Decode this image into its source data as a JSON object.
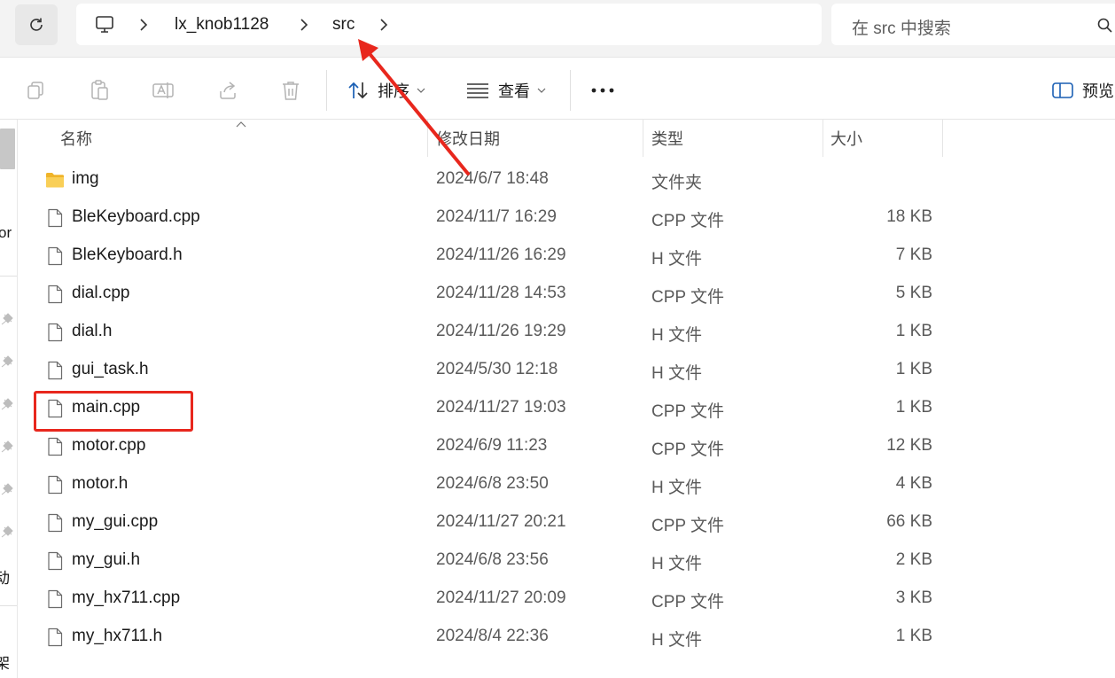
{
  "address_bar": {
    "breadcrumbs": [
      {
        "label": "lx_knob1128"
      },
      {
        "label": "src"
      }
    ],
    "search_placeholder": "在 src 中搜索"
  },
  "command_bar": {
    "sort_label": "排序",
    "view_label": "查看",
    "more_label": "•••",
    "preview_label": "预览"
  },
  "nav_pane": {
    "fragments": [
      "or",
      "动",
      "架"
    ]
  },
  "columns": {
    "name": "名称",
    "modified": "修改日期",
    "type": "类型",
    "size": "大小"
  },
  "files": [
    {
      "name": "img",
      "modified": "2024/6/7 18:48",
      "type": "文件夹",
      "size": "",
      "icon": "folder-icon"
    },
    {
      "name": "BleKeyboard.cpp",
      "modified": "2024/11/7 16:29",
      "type": "CPP 文件",
      "size": "18 KB",
      "icon": "file-icon"
    },
    {
      "name": "BleKeyboard.h",
      "modified": "2024/11/26 16:29",
      "type": "H 文件",
      "size": "7 KB",
      "icon": "file-icon"
    },
    {
      "name": "dial.cpp",
      "modified": "2024/11/28 14:53",
      "type": "CPP 文件",
      "size": "5 KB",
      "icon": "file-icon"
    },
    {
      "name": "dial.h",
      "modified": "2024/11/26 19:29",
      "type": "H 文件",
      "size": "1 KB",
      "icon": "file-icon"
    },
    {
      "name": "gui_task.h",
      "modified": "2024/5/30 12:18",
      "type": "H 文件",
      "size": "1 KB",
      "icon": "file-icon"
    },
    {
      "name": "main.cpp",
      "modified": "2024/11/27 19:03",
      "type": "CPP 文件",
      "size": "1 KB",
      "icon": "file-icon"
    },
    {
      "name": "motor.cpp",
      "modified": "2024/6/9 11:23",
      "type": "CPP 文件",
      "size": "12 KB",
      "icon": "file-icon"
    },
    {
      "name": "motor.h",
      "modified": "2024/6/8 23:50",
      "type": "H 文件",
      "size": "4 KB",
      "icon": "file-icon"
    },
    {
      "name": "my_gui.cpp",
      "modified": "2024/11/27 20:21",
      "type": "CPP 文件",
      "size": "66 KB",
      "icon": "file-icon"
    },
    {
      "name": "my_gui.h",
      "modified": "2024/6/8 23:56",
      "type": "H 文件",
      "size": "2 KB",
      "icon": "file-icon"
    },
    {
      "name": "my_hx711.cpp",
      "modified": "2024/11/27 20:09",
      "type": "CPP 文件",
      "size": "3 KB",
      "icon": "file-icon"
    },
    {
      "name": "my_hx711.h",
      "modified": "2024/8/4 22:36",
      "type": "H 文件",
      "size": "1 KB",
      "icon": "file-icon"
    }
  ],
  "annotation_colors": {
    "highlight": "#e8271d",
    "folder": "#f7c544"
  }
}
